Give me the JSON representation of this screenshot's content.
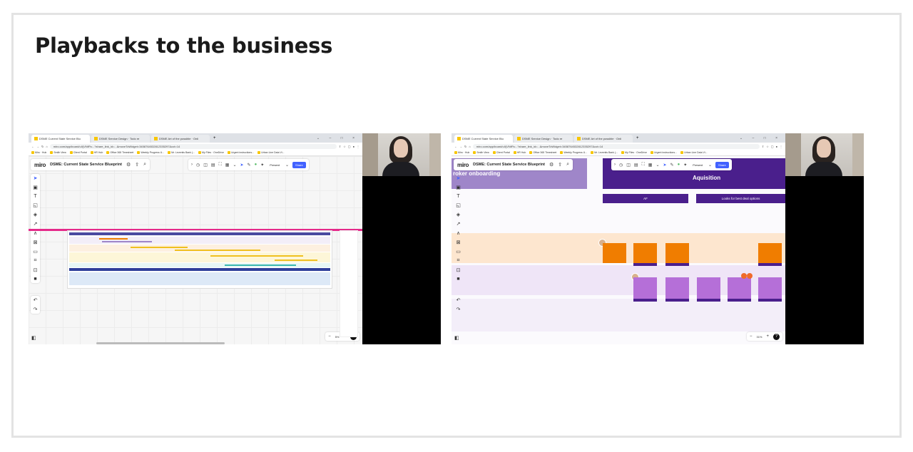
{
  "slide": {
    "title": "Playbacks to the business"
  },
  "screenshots": [
    {
      "tabs": [
        "DSME Current State Service Blu",
        "DSME Service Design · Todo re",
        "DSME Art of the possible · Onli"
      ],
      "url": "miro.com/app/board/uXjVNtFiv...?share_link_id=...&moveToWidget=3458764532812335297&cot=14",
      "bookmarks": [
        "Miro · Hub",
        "Smith View",
        "Client Portal",
        "HR Hub",
        "Office 365 Timesheet",
        "Weekly Progress U...",
        "Mr. Leventis Bank (...",
        "My Files · OneDrive",
        "Urgent instructions...",
        "Urban Line Data Vi..."
      ],
      "board_name": "DSME: Current State Service Blueprint",
      "present_label": "Present",
      "share_label": "Share",
      "zoom_level": "5%"
    },
    {
      "tabs": [
        "DSME Current State Service Blu",
        "DSME Service Design · Todo re",
        "DSME Art of the possible · Onli"
      ],
      "url": "miro.com/app/board/uXjVNtFiv...?share_link_id=...&moveToWidget=3458764532812335297&cot=14",
      "bookmarks": [
        "Miro · Hub",
        "Smith View",
        "Client Portal",
        "HR Hub",
        "Office 365 Timesheet",
        "Weekly Progress U...",
        "Mr. Leventis Bank (...",
        "My Files · OneDrive",
        "Urgent instructions...",
        "Urban Line Data Vi..."
      ],
      "board_name": "DSME: Current State Service Blueprint",
      "present_label": "Present",
      "share_label": "Share",
      "zoom_level": "31%",
      "section_left": "roker onboarding",
      "section_right": "Aquisition",
      "pills": [
        "AF",
        "Looks for best deal options"
      ]
    }
  ],
  "colors": {
    "accent": "#4262ff",
    "purple_dark": "#4a1f8c",
    "purple_light": "#9f86c9",
    "orange": "#f07d00",
    "pink_line": "#e52a8a"
  }
}
